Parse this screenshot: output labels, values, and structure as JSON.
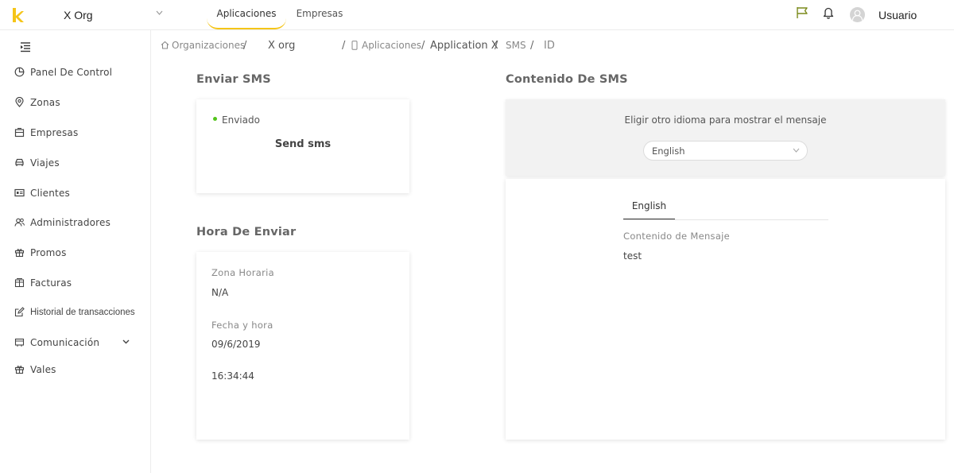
{
  "topbar": {
    "org_name": "X Org",
    "tabs": [
      {
        "label": "Aplicaciones",
        "active": true
      },
      {
        "label": "Empresas",
        "active": false
      }
    ],
    "user_name": "Usuario",
    "accent_color": "#f5c518",
    "icons": [
      "logo-k-icon",
      "chevron-down-icon",
      "flag-icon",
      "bell-icon",
      "user-avatar-icon"
    ]
  },
  "sidebar": {
    "items": [
      {
        "label": "Panel De Control",
        "icon": "pie-chart-icon"
      },
      {
        "label": "Zonas",
        "icon": "map-pin-icon"
      },
      {
        "label": "Empresas",
        "icon": "building-icon"
      },
      {
        "label": "Viajes",
        "icon": "car-icon"
      },
      {
        "label": "Clientes",
        "icon": "id-card-icon"
      },
      {
        "label": "Administradores",
        "icon": "users-icon"
      },
      {
        "label": "Promos",
        "icon": "gift-icon"
      },
      {
        "label": "Facturas",
        "icon": "invoice-icon"
      },
      {
        "label": "Historial de transacciones",
        "icon": "edit-icon"
      },
      {
        "label": "Comunicación",
        "icon": "message-icon",
        "expandable": true
      },
      {
        "label": "Vales",
        "icon": "gift-icon"
      }
    ]
  },
  "breadcrumb": {
    "home": "Organizaciones",
    "org": "X org",
    "apps": "Aplicaciones",
    "app": "Application X",
    "sms": "SMS",
    "id": "ID",
    "separator": "/"
  },
  "send_section": {
    "title": "Enviar SMS",
    "status": "Enviado",
    "status_color": "#52c41a",
    "card_title": "Send sms"
  },
  "time_section": {
    "title": "Hora De Enviar",
    "timezone_label": "Zona Horaria",
    "timezone_value": "N/A",
    "datetime_label": "Fecha y hora",
    "date_value": "09/6/2019",
    "time_value": "16:34:44"
  },
  "content_section": {
    "title": "Contenido De SMS",
    "language_prompt": "Eligir otro idioma para mostrar el mensaje",
    "language_selected": "English",
    "tab_label": "English",
    "message_label": "Contenido de Mensaje",
    "message_value": "test"
  }
}
